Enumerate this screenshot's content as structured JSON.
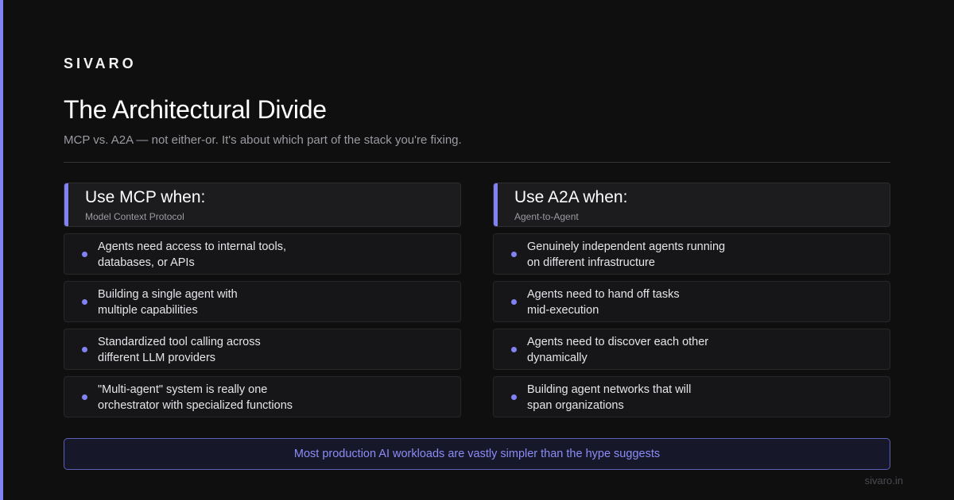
{
  "brand": {
    "logo": "SIVARO",
    "footer_domain": "sivaro.in",
    "accent_color": "#8183f4"
  },
  "header": {
    "title": "The Architectural Divide",
    "subtitle": "MCP vs. A2A — not either-or. It's about which part of the stack you're fixing."
  },
  "columns": [
    {
      "title": "Use MCP when:",
      "subtitle": "Model Context Protocol",
      "items": [
        "Agents need access to internal tools,\ndatabases, or APIs",
        "Building a single agent with\nmultiple capabilities",
        "Standardized tool calling across\ndifferent LLM providers",
        "\"Multi-agent\" system is really one\norchestrator with specialized functions"
      ]
    },
    {
      "title": "Use A2A when:",
      "subtitle": "Agent-to-Agent",
      "items": [
        "Genuinely independent agents running\non different infrastructure",
        "Agents need to hand off tasks\nmid-execution",
        "Agents need to discover each other\ndynamically",
        "Building agent networks that will\nspan organizations"
      ]
    }
  ],
  "callout": "Most production AI workloads are vastly simpler than the hype suggests"
}
